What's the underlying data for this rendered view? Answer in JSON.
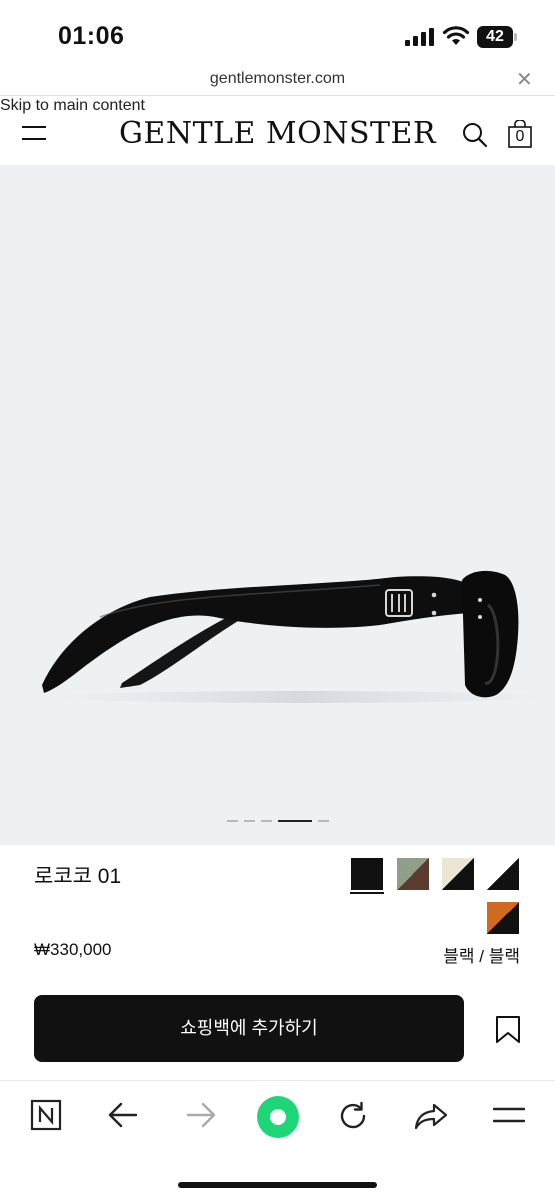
{
  "status_bar": {
    "time": "01:06",
    "battery_level": "42",
    "icons": [
      "signal-icon",
      "wifi-icon",
      "battery-icon"
    ]
  },
  "browser": {
    "url": "gentlemonster.com",
    "close_icon": "✕",
    "toolbar_icons": [
      "naver-home-icon",
      "back-arrow-icon",
      "forward-arrow-icon",
      "green-circle-icon",
      "reload-icon",
      "share-icon",
      "menu-icon"
    ]
  },
  "header": {
    "skip_link": "Skip to main content",
    "logo": "GENTLE MONSTER",
    "bag_count": "0",
    "icons": [
      "hamburger-menu-icon",
      "search-icon",
      "shopping-bag-icon"
    ]
  },
  "carousel": {
    "slide_count": 5,
    "active_index": 3
  },
  "product": {
    "name": "로코코 01",
    "price": "₩330,000",
    "selected_color": "블랙 / 블랙",
    "swatches": [
      {
        "id": "black",
        "colors": [
          "#111111",
          "#111111"
        ],
        "selected": true
      },
      {
        "id": "green-brown",
        "colors": [
          "#8f9f8a",
          "#5b3b2f"
        ],
        "selected": false
      },
      {
        "id": "ivory-black",
        "colors": [
          "#ece6d4",
          "#111111"
        ],
        "selected": false
      },
      {
        "id": "white-black",
        "colors": [
          "#ffffff",
          "#111111"
        ],
        "selected": false
      },
      {
        "id": "orange-black",
        "colors": [
          "#d16a1e",
          "#111111"
        ],
        "selected": false
      }
    ],
    "add_to_bag_label": "쇼핑백에 추가하기",
    "wishlist_icon": "bookmark-icon"
  },
  "colors": {
    "accent_green": "#1ed678",
    "button_bg": "#111111",
    "image_bg": "#eef1f4"
  }
}
